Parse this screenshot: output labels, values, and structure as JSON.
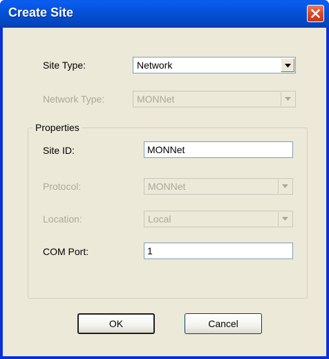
{
  "window": {
    "title": "Create Site"
  },
  "fields": {
    "site_type": {
      "label": "Site Type:",
      "value": "Network",
      "enabled": true
    },
    "network_type": {
      "label": "Network Type:",
      "value": "MONNet",
      "enabled": false
    }
  },
  "properties": {
    "legend": "Properties",
    "site_id": {
      "label": "Site ID:",
      "value": "MONNet"
    },
    "protocol": {
      "label": "Protocol:",
      "value": "MONNet",
      "enabled": false
    },
    "location": {
      "label": "Location:",
      "value": "Local",
      "enabled": false
    },
    "com_port": {
      "label": "COM Port:",
      "value": "1"
    }
  },
  "buttons": {
    "ok": "OK",
    "cancel": "Cancel"
  },
  "colors": {
    "titlebar": "#0451d6",
    "dialog_bg": "#ece9d8",
    "close_button": "#d94a2a",
    "disabled_text": "#aca899"
  }
}
